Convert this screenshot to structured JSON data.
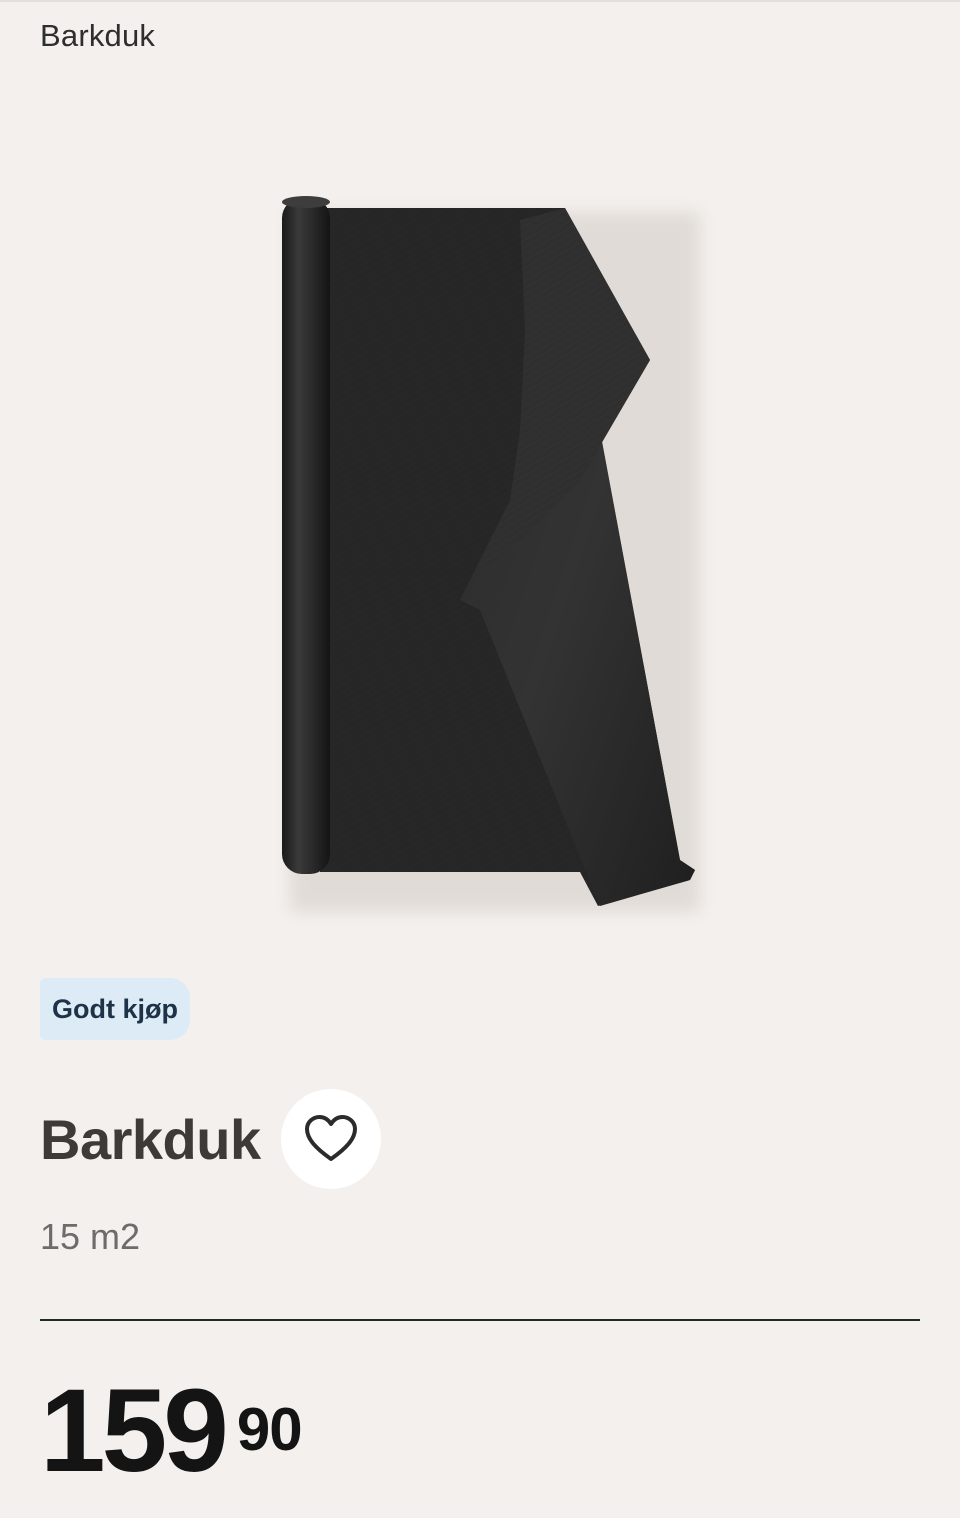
{
  "breadcrumb": "Barkduk",
  "product": {
    "image_alt": "barkduk-roll",
    "badge": "Godt kjøp",
    "title": "Barkduk",
    "size": "15 m2",
    "favorite_icon": "heart-outline-icon",
    "price": {
      "main": "159",
      "cents": "90"
    }
  },
  "colors": {
    "background": "#f4f0ed",
    "badge_bg": "#dcebf5",
    "badge_text": "#1f3348",
    "divider": "#1e2a22",
    "price_text": "#141414"
  }
}
